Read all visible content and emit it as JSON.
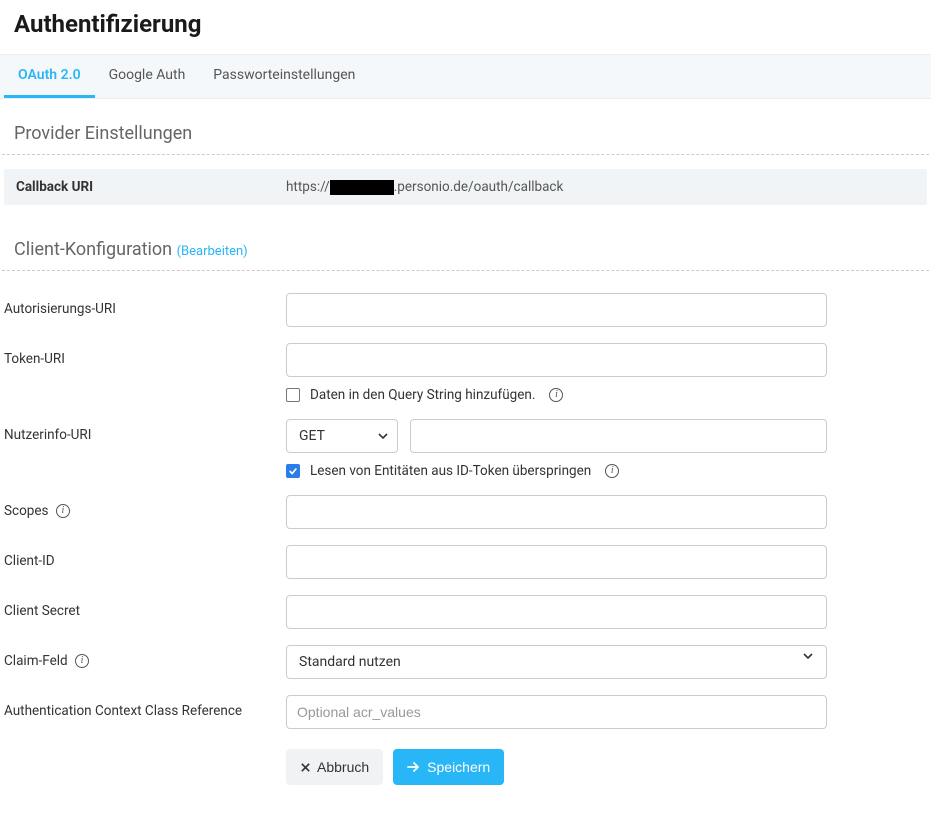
{
  "page_title": "Authentifizierung",
  "tabs": [
    {
      "label": "OAuth 2.0",
      "active": true
    },
    {
      "label": "Google Auth",
      "active": false
    },
    {
      "label": "Passworteinstellungen",
      "active": false
    }
  ],
  "provider_section": {
    "heading": "Provider Einstellungen",
    "callback_label": "Callback URI",
    "callback_prefix": "https://",
    "callback_suffix": ".personio.de/oauth/callback"
  },
  "client_section": {
    "heading": "Client-Konfiguration",
    "edit_text": "(Bearbeiten)"
  },
  "fields": {
    "auth_uri_label": "Autorisierungs-URI",
    "auth_uri_value": "",
    "token_uri_label": "Token-URI",
    "token_uri_value": "",
    "query_string_checkbox_label": "Daten in den Query String hinzufügen.",
    "query_string_checked": false,
    "userinfo_uri_label": "Nutzerinfo-URI",
    "userinfo_method": "GET",
    "userinfo_uri_value": "",
    "skip_id_token_label": "Lesen von Entitäten aus ID-Token überspringen",
    "skip_id_token_checked": true,
    "scopes_label": "Scopes",
    "scopes_value": "",
    "client_id_label": "Client-ID",
    "client_id_value": "",
    "client_secret_label": "Client Secret",
    "client_secret_value": "",
    "claim_field_label": "Claim-Feld",
    "claim_field_selected": "Standard nutzen",
    "acr_label": "Authentication Context Class Reference",
    "acr_placeholder": "Optional acr_values",
    "acr_value": ""
  },
  "buttons": {
    "cancel": "Abbruch",
    "save": "Speichern"
  }
}
